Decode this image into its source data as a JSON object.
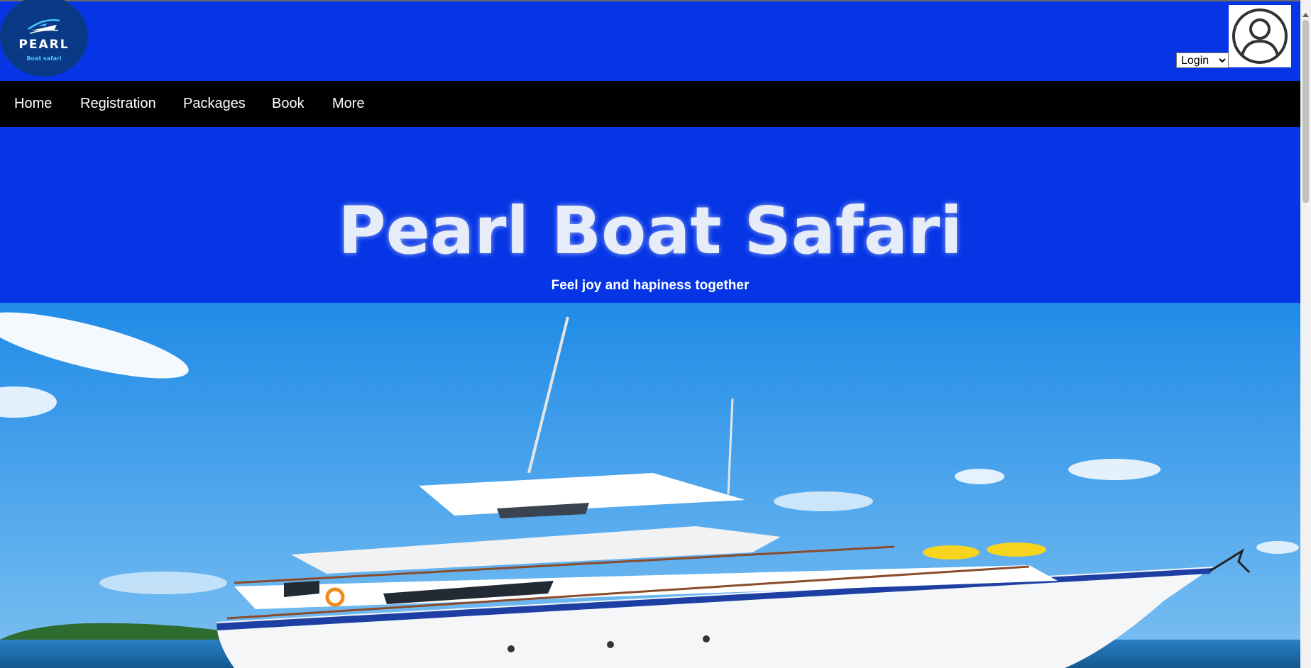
{
  "header": {
    "logo": {
      "brand": "PEARL",
      "tagline": "Boat safari",
      "icon": "boat-logo-icon"
    },
    "login_select": {
      "selected": "Login",
      "options": [
        "Login"
      ]
    },
    "avatar_icon": "user-avatar-icon"
  },
  "nav": {
    "items": [
      {
        "label": "Home"
      },
      {
        "label": "Registration"
      },
      {
        "label": "Packages"
      },
      {
        "label": "Book"
      },
      {
        "label": "More"
      }
    ]
  },
  "hero": {
    "title": "Pearl Boat Safari",
    "subtitle": "Feel joy and hapiness together",
    "image": "yacht-at-sea-photo"
  },
  "colors": {
    "header_blue": "#0535e5",
    "nav_black": "#000000",
    "logo_circle": "#0a3a86",
    "sky": "#3f97e8",
    "sea": "#1b6fb5"
  }
}
